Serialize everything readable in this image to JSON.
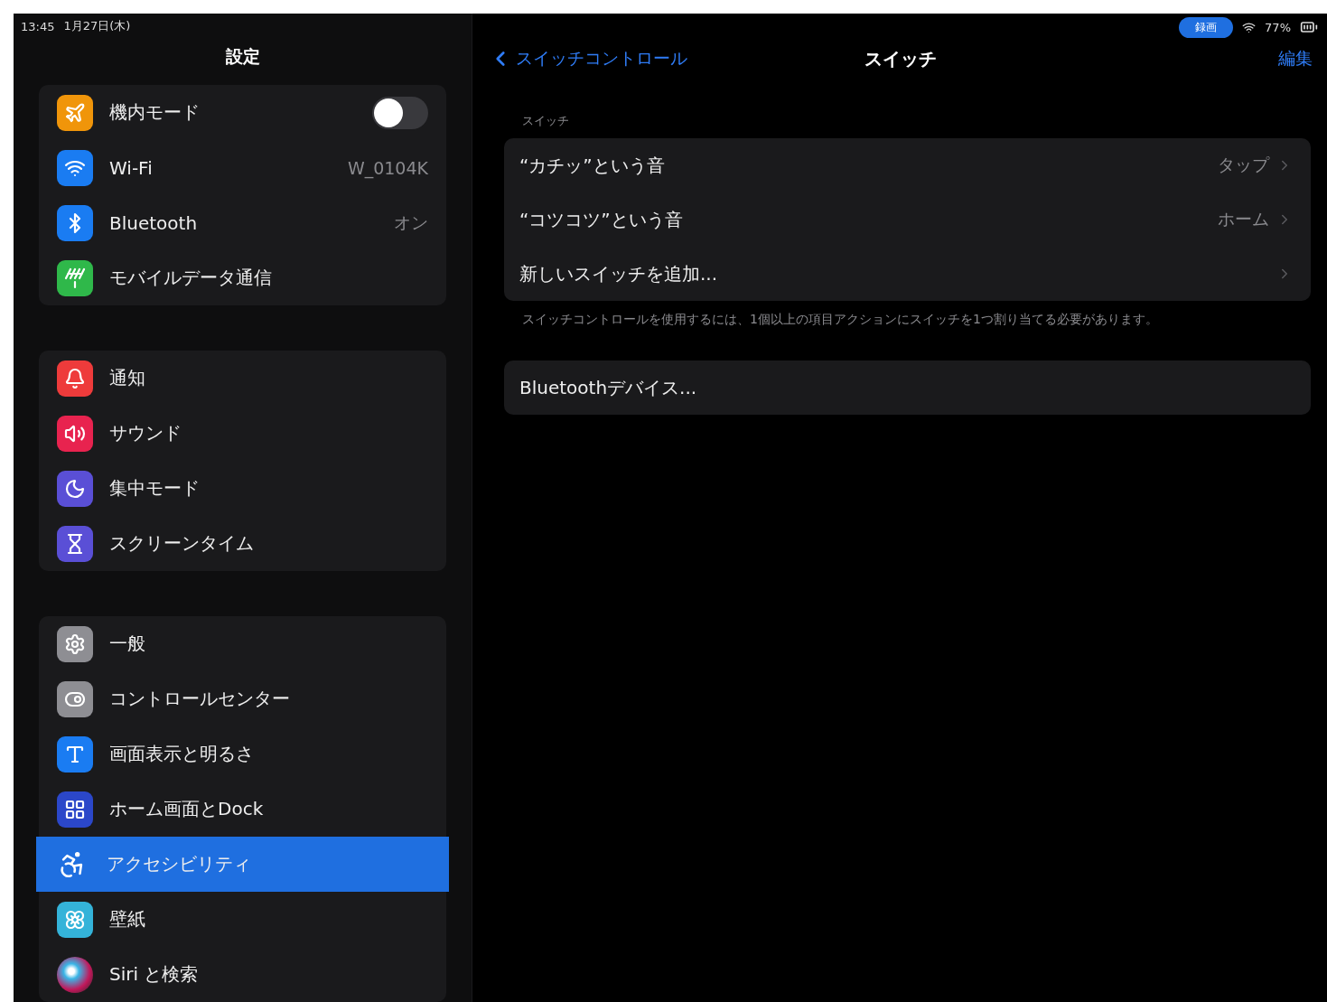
{
  "status_bar": {
    "time": "13:45",
    "date": "1月27日(木)",
    "recording": "録画",
    "battery": "77%"
  },
  "sidebar": {
    "title": "設定",
    "groups": [
      [
        {
          "kind": "airplane",
          "label": "機内モード",
          "on": false,
          "selected": false
        },
        {
          "kind": "wifi",
          "label": "Wi-Fi",
          "value": "W_0104K",
          "selected": false
        },
        {
          "kind": "bluetooth",
          "label": "Bluetooth",
          "value": "オン",
          "selected": false
        },
        {
          "kind": "antenna",
          "label": "モバイルデータ通信",
          "selected": false
        }
      ],
      [
        {
          "kind": "bell",
          "label": "通知",
          "selected": false
        },
        {
          "kind": "speaker",
          "label": "サウンド",
          "selected": false
        },
        {
          "kind": "moon",
          "label": "集中モード",
          "selected": false
        },
        {
          "kind": "hourglass",
          "label": "スクリーンタイム",
          "selected": false
        }
      ],
      [
        {
          "kind": "gear",
          "label": "一般",
          "selected": false
        },
        {
          "kind": "toggles",
          "label": "コントロールセンター",
          "selected": false
        },
        {
          "kind": "text-size",
          "label": "画面表示と明るさ",
          "selected": false
        },
        {
          "kind": "grid",
          "label": "ホーム画面とDock",
          "selected": false
        },
        {
          "kind": "accessibility",
          "label": "アクセシビリティ",
          "selected": true
        },
        {
          "kind": "flower",
          "label": "壁紙",
          "selected": false
        },
        {
          "kind": "siri",
          "label": "Siri と検索",
          "selected": false
        }
      ]
    ]
  },
  "detail": {
    "back": "スイッチコントロール",
    "title": "スイッチ",
    "action": "編集",
    "section_header": "スイッチ",
    "rows": [
      {
        "label": "“カチッ”という音",
        "value": "タップ"
      },
      {
        "label": "“コツコツ”という音",
        "value": "ホーム"
      },
      {
        "label": "新しいスイッチを追加..."
      }
    ],
    "footer": "スイッチコントロールを使用するには、1個以上の項目アクションにスイッチを1つ割り当てる必要があります。",
    "bluetooth_row": {
      "label": "Bluetoothデバイス..."
    }
  }
}
